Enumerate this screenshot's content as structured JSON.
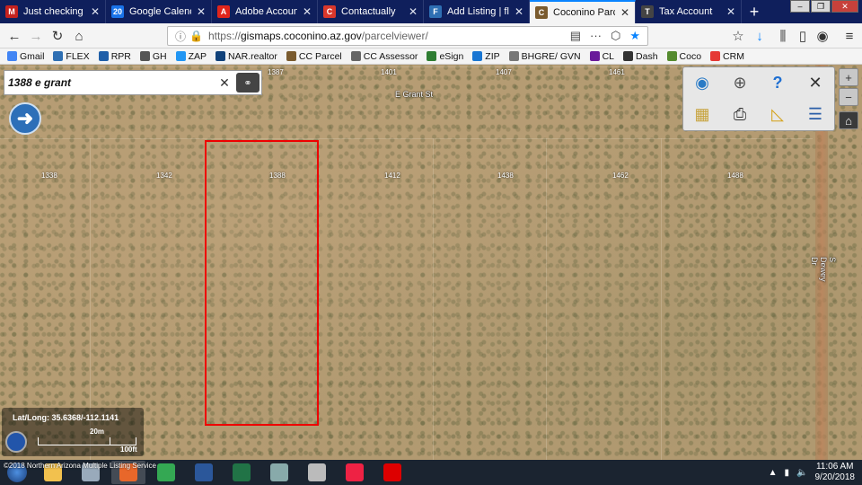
{
  "browser": {
    "tabs": [
      {
        "title": "Just checking in - M",
        "icon": "gmail-icon",
        "color": "#c5221f",
        "glyph": "M",
        "active": false
      },
      {
        "title": "Google Calendar - W",
        "icon": "calendar-icon",
        "color": "#1a73e8",
        "glyph": "20",
        "active": false
      },
      {
        "title": "Adobe Account",
        "icon": "adobe-icon",
        "color": "#e1251b",
        "glyph": "A",
        "active": false
      },
      {
        "title": "Contactually",
        "icon": "contactually-icon",
        "color": "#d9372b",
        "glyph": "C",
        "active": false
      },
      {
        "title": "Add Listing | flexmls",
        "icon": "flexmls-icon",
        "color": "#2e6fb3",
        "glyph": "F",
        "active": false
      },
      {
        "title": "Coconino Parcel Viewer",
        "icon": "map-icon",
        "color": "#7a5b2e",
        "glyph": "C",
        "active": true
      },
      {
        "title": "Tax Account",
        "icon": "tax-icon",
        "color": "#444444",
        "glyph": "T",
        "active": false
      }
    ],
    "new_tab_glyph": "+",
    "window_controls": [
      "–",
      "❐",
      "✕"
    ],
    "url": {
      "protocol": "https://",
      "domain": "gismaps.coconino.az.gov",
      "path": "/parcelviewer/"
    },
    "bookmarks": [
      {
        "label": "Gmail",
        "color": "#4285f4"
      },
      {
        "label": "FLEX",
        "color": "#2e6fb3"
      },
      {
        "label": "RPR",
        "color": "#1f5fa8"
      },
      {
        "label": "GH",
        "color": "#555555"
      },
      {
        "label": "ZAP",
        "color": "#2196f3"
      },
      {
        "label": "NAR.realtor",
        "color": "#11427a"
      },
      {
        "label": "CC Parcel",
        "color": "#7a5b2e"
      },
      {
        "label": "CC Assessor",
        "color": "#666666"
      },
      {
        "label": "eSign",
        "color": "#2e7d32"
      },
      {
        "label": "ZIP",
        "color": "#1976d2"
      },
      {
        "label": "BHGRE/ GVN",
        "color": "#777777"
      },
      {
        "label": "CL",
        "color": "#6a1b9a"
      },
      {
        "label": "Dash",
        "color": "#333333"
      },
      {
        "label": "Coco",
        "color": "#558b2f"
      },
      {
        "label": "CRM",
        "color": "#e53935"
      }
    ]
  },
  "map": {
    "search_value": "1388 e grant",
    "parcel_numbers": [
      "1387",
      "1401",
      "1407",
      "1461",
      "1338",
      "1342",
      "1388",
      "1412",
      "1438",
      "1462",
      "1488"
    ],
    "streets": [
      "E Grant St",
      "S Dewey Dr"
    ],
    "lat_long_label": "Lat/Long:",
    "lat_long_value": "35.6368/-112.1141",
    "scale_top": "20m",
    "scale_bottom": "100ft",
    "watermark": "©2018 Northern Arizona Multiple Listing Service"
  },
  "taskbar": {
    "time": "11:06 AM",
    "date": "9/20/2018",
    "apps": [
      {
        "name": "explorer-icon",
        "color": "#f2c14e"
      },
      {
        "name": "calculator-icon",
        "color": "#9ab"
      },
      {
        "name": "firefox-icon",
        "color": "#e8672a"
      },
      {
        "name": "chrome-icon",
        "color": "#34a853"
      },
      {
        "name": "word-icon",
        "color": "#2b579a"
      },
      {
        "name": "excel-icon",
        "color": "#217346"
      },
      {
        "name": "sharefile-icon",
        "color": "#8aa"
      },
      {
        "name": "pro-icon",
        "color": "#bbb"
      },
      {
        "name": "itunes-icon",
        "color": "#e24"
      },
      {
        "name": "acrobat-icon",
        "color": "#d00"
      }
    ]
  }
}
